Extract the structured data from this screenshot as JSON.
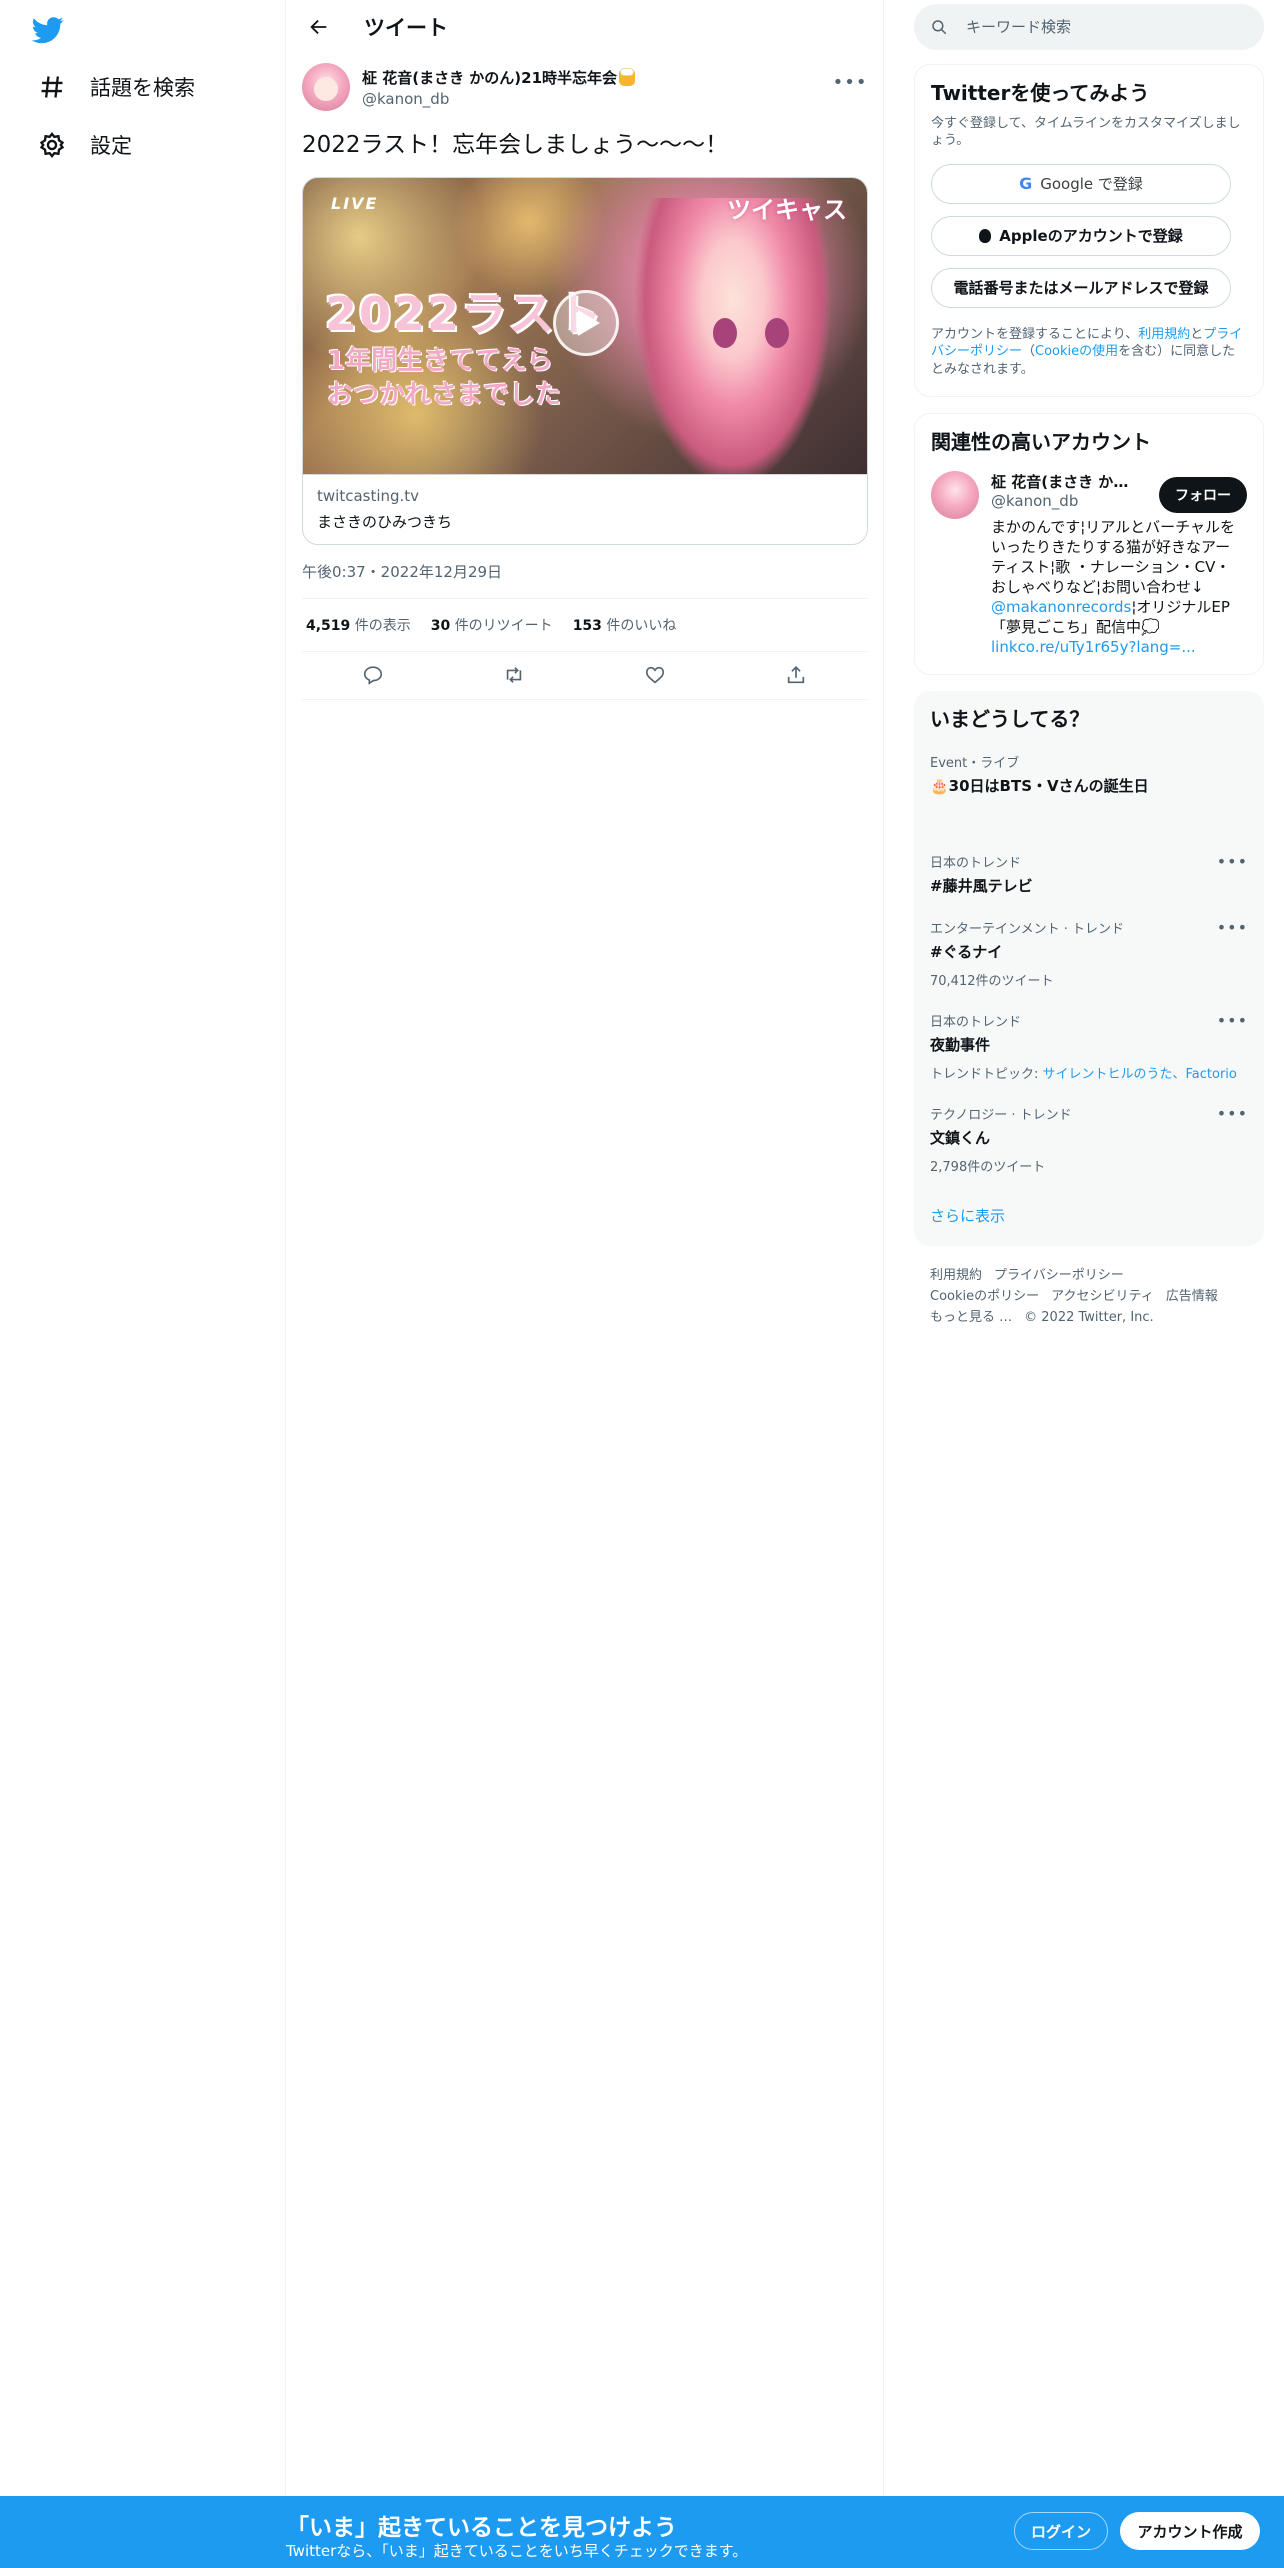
{
  "nav": {
    "explore_label": "話題を検索",
    "settings_label": "設定"
  },
  "header": {
    "title": "ツイート"
  },
  "tweet": {
    "display_name": "柾 花音(まさき かのん)21時半忘年会",
    "handle": "@kanon_db",
    "text": "2022ラスト！忘年会しましょう～～～！",
    "card": {
      "live_label": "LIVE",
      "brand_label": "ツイキャス",
      "overlay_title": "2022ラスト",
      "overlay_line2": "1年間生きててえら",
      "overlay_line3": "おつかれさまでした",
      "domain": "twitcasting.tv",
      "title": "まさきのひみつきち"
    },
    "timestamp": "午後0:37・2022年12月29日",
    "stats": {
      "views_count": "4,519",
      "views_label": "件の表示",
      "retweets_count": "30",
      "retweets_label": "件のリツイート",
      "likes_count": "153",
      "likes_label": "件のいいね"
    }
  },
  "search": {
    "placeholder": "キーワード検索"
  },
  "signup_panel": {
    "title": "Twitterを使ってみよう",
    "subtitle": "今すぐ登録して、タイムラインをカスタマイズしましょう。",
    "google_label": "Google で登録",
    "apple_label": "Appleのアカウントで登録",
    "phone_label": "電話番号またはメールアドレスで登録",
    "terms_prefix": "アカウントを登録することにより、",
    "terms_link1": "利用規約",
    "terms_and": "と",
    "terms_link2": "プライバシーポリシー",
    "terms_paren_open": "（",
    "terms_link3": "Cookieの使用",
    "terms_suffix": "を含む）に同意したとみなされます。"
  },
  "relevant_panel": {
    "title": "関連性の高いアカウント",
    "account": {
      "name": "柾 花音(まさき かのん)",
      "handle": "@kanon_db",
      "follow_label": "フォロー",
      "bio_part1": "まかのんです¦リアルとバーチャルをいったりきたりする猫が好きなアーティスト¦歌 ・ナレーション・CV・おしゃべりなど¦お問い合わせ↓",
      "bio_link1": "@makanonrecords",
      "bio_part2": "¦オリジナルEP「夢見ごこち」配信中💭",
      "bio_link2": "linkco.re/uTy1r65y?lang=..."
    }
  },
  "trends_panel": {
    "title": "いまどうしてる？",
    "event_meta": "Event・ライブ",
    "event_name": "🎂30日はBTS・Vさんの誕生日",
    "items": [
      {
        "meta": "日本のトレンド",
        "name": "#藤井風テレビ",
        "sub": ""
      },
      {
        "meta": "エンターテインメント · トレンド",
        "name": "#ぐるナイ",
        "sub": "70,412件のツイート"
      },
      {
        "meta": "日本のトレンド",
        "name": "夜勤事件",
        "sub_prefix": "トレンドトピック: ",
        "sub_link": "サイレントヒルのうた、Factorio"
      },
      {
        "meta": "テクノロジー · トレンド",
        "name": "文鎮くん",
        "sub": "2,798件のツイート"
      }
    ],
    "show_more": "さらに表示"
  },
  "footer": {
    "terms": "利用規約",
    "privacy": "プライバシーポリシー",
    "cookie": "Cookieのポリシー",
    "accessibility": "アクセシビリティ",
    "ads": "広告情報",
    "more": "もっと見る …",
    "copyright": "© 2022 Twitter, Inc."
  },
  "banner": {
    "title": "「いま」起きていることを見つけよう",
    "subtitle": "Twitterなら、「いま」起きていることをいち早くチェックできます。",
    "login_label": "ログイン",
    "signup_label": "アカウント作成"
  },
  "colors": {
    "brand": "#1d9bf0",
    "text": "#0f1419",
    "secondary": "#536471"
  }
}
